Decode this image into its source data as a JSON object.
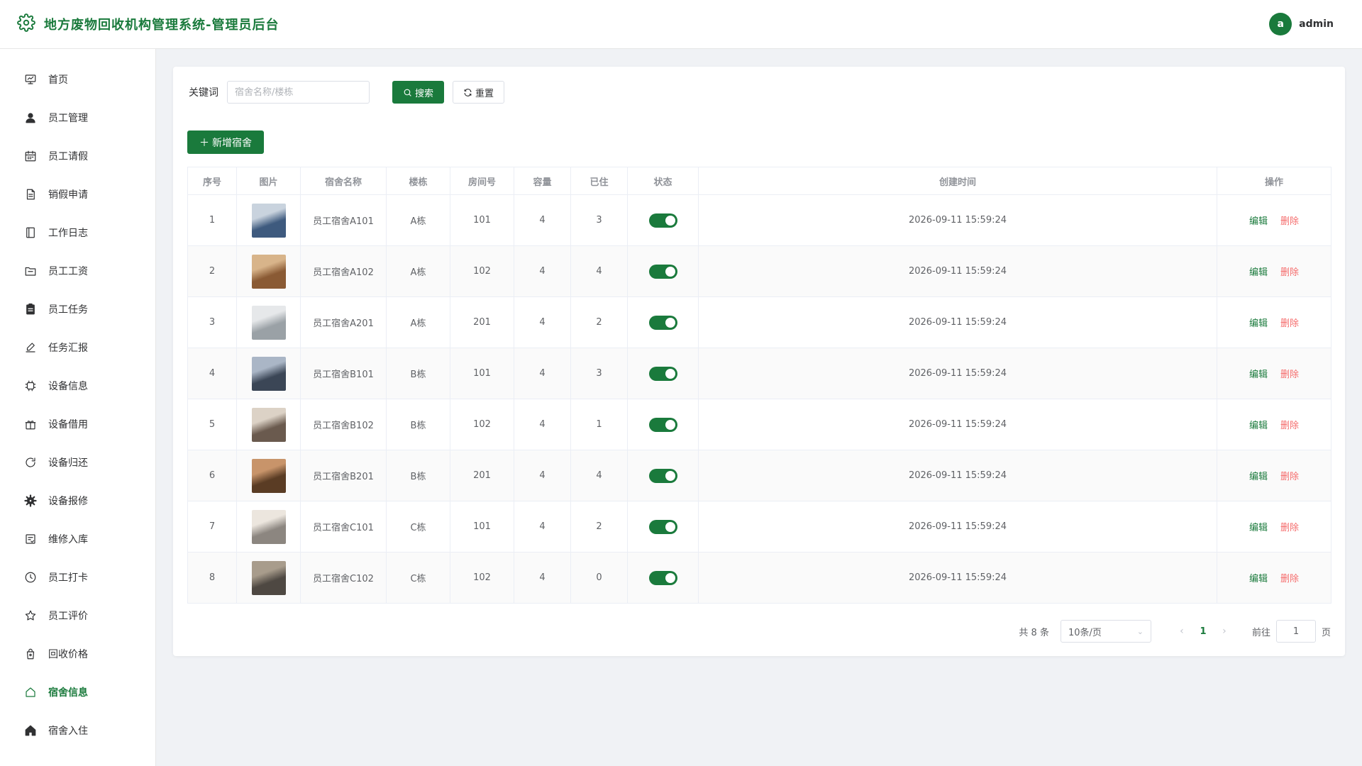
{
  "header": {
    "title": "地方废物回收机构管理系统-管理员后台",
    "logo_icon": "gear-icon",
    "avatar_letter": "a",
    "username": "admin"
  },
  "sidebar": {
    "items": [
      {
        "label": "首页",
        "icon": "presentation-icon",
        "name": "home"
      },
      {
        "label": "员工管理",
        "icon": "user-icon",
        "name": "employee-manage"
      },
      {
        "label": "员工请假",
        "icon": "calendar-icon",
        "name": "employee-leave"
      },
      {
        "label": "销假申请",
        "icon": "document-icon",
        "name": "leave-cancel"
      },
      {
        "label": "工作日志",
        "icon": "notebook-icon",
        "name": "work-log"
      },
      {
        "label": "员工工资",
        "icon": "folder-icon",
        "name": "employee-salary"
      },
      {
        "label": "员工任务",
        "icon": "clipboard-icon",
        "name": "employee-task"
      },
      {
        "label": "任务汇报",
        "icon": "edit-icon",
        "name": "task-report"
      },
      {
        "label": "设备信息",
        "icon": "cpu-icon",
        "name": "equipment-info"
      },
      {
        "label": "设备借用",
        "icon": "gift-icon",
        "name": "equipment-borrow"
      },
      {
        "label": "设备归还",
        "icon": "refresh-icon",
        "name": "equipment-return"
      },
      {
        "label": "设备报修",
        "icon": "setting-icon",
        "name": "equipment-repair"
      },
      {
        "label": "维修入库",
        "icon": "box-icon",
        "name": "repair-storage"
      },
      {
        "label": "员工打卡",
        "icon": "clock-icon",
        "name": "employee-checkin"
      },
      {
        "label": "员工评价",
        "icon": "star-icon",
        "name": "employee-rating"
      },
      {
        "label": "回收价格",
        "icon": "bag-icon",
        "name": "recycle-price"
      },
      {
        "label": "宿舍信息",
        "icon": "house-icon",
        "name": "dorm-info",
        "active": true
      },
      {
        "label": "宿舍入住",
        "icon": "home-filled-icon",
        "name": "dorm-checkin"
      }
    ]
  },
  "search": {
    "label": "关键词",
    "placeholder": "宿舍名称/楼栋",
    "value": "",
    "search_button": "搜索",
    "reset_button": "重置"
  },
  "toolbar": {
    "add_button": "新增宿舍"
  },
  "table": {
    "columns": [
      "序号",
      "图片",
      "宿舍名称",
      "楼栋",
      "房间号",
      "容量",
      "已住",
      "状态",
      "创建时间",
      "操作"
    ],
    "edit_label": "编辑",
    "delete_label": "删除",
    "rows": [
      {
        "index": "1",
        "name": "员工宿舍A101",
        "building": "A栋",
        "room": "101",
        "capacity": "4",
        "occupied": "3",
        "status_on": true,
        "created": "2026-09-11 15:59:24",
        "img_a": "#3e5a7e",
        "img_b": "#c9d3de"
      },
      {
        "index": "2",
        "name": "员工宿舍A102",
        "building": "A栋",
        "room": "102",
        "capacity": "4",
        "occupied": "4",
        "status_on": true,
        "created": "2026-09-11 15:59:24",
        "img_a": "#8a5a34",
        "img_b": "#d8b48a"
      },
      {
        "index": "3",
        "name": "员工宿舍A201",
        "building": "A栋",
        "room": "201",
        "capacity": "4",
        "occupied": "2",
        "status_on": true,
        "created": "2026-09-11 15:59:24",
        "img_a": "#9aa1a6",
        "img_b": "#e6e8ea"
      },
      {
        "index": "4",
        "name": "员工宿舍B101",
        "building": "B栋",
        "room": "101",
        "capacity": "4",
        "occupied": "3",
        "status_on": true,
        "created": "2026-09-11 15:59:24",
        "img_a": "#3b4656",
        "img_b": "#aab6c6"
      },
      {
        "index": "5",
        "name": "员工宿舍B102",
        "building": "B栋",
        "room": "102",
        "capacity": "4",
        "occupied": "1",
        "status_on": true,
        "created": "2026-09-11 15:59:24",
        "img_a": "#6a5a4e",
        "img_b": "#dcd2c6"
      },
      {
        "index": "6",
        "name": "员工宿舍B201",
        "building": "B栋",
        "room": "201",
        "capacity": "4",
        "occupied": "4",
        "status_on": true,
        "created": "2026-09-11 15:59:24",
        "img_a": "#5a3c24",
        "img_b": "#c8946a"
      },
      {
        "index": "7",
        "name": "员工宿舍C101",
        "building": "C栋",
        "room": "101",
        "capacity": "4",
        "occupied": "2",
        "status_on": true,
        "created": "2026-09-11 15:59:24",
        "img_a": "#8c8680",
        "img_b": "#ece6de"
      },
      {
        "index": "8",
        "name": "员工宿舍C102",
        "building": "C栋",
        "room": "102",
        "capacity": "4",
        "occupied": "0",
        "status_on": true,
        "created": "2026-09-11 15:59:24",
        "img_a": "#4e4842",
        "img_b": "#a89c8c"
      }
    ]
  },
  "pagination": {
    "total_text": "共 8 条",
    "page_size": "10条/页",
    "current_page": "1",
    "goto_label": "前往",
    "goto_value": "1",
    "page_suffix": "页"
  },
  "colors": {
    "accent": "#1a7a3c",
    "danger": "#f56c6c"
  }
}
